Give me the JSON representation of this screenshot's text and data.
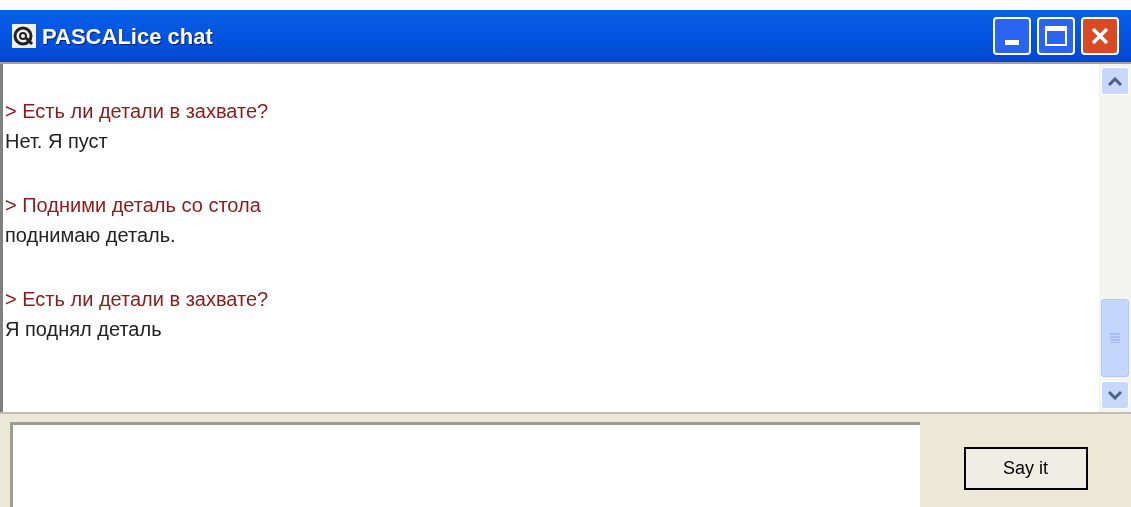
{
  "window": {
    "title": "PASCALice chat"
  },
  "messages": [
    {
      "kind": "user",
      "text": "> Есть ли детали в захвате?"
    },
    {
      "kind": "bot",
      "text": "Нет. Я пуст"
    },
    {
      "kind": "user",
      "text": "> Подними деталь со стола"
    },
    {
      "kind": "bot",
      "text": "поднимаю деталь."
    },
    {
      "kind": "user",
      "text": "> Есть ли детали в захвате?"
    },
    {
      "kind": "bot",
      "text": "Я поднял деталь"
    }
  ],
  "send_button": "Say it"
}
